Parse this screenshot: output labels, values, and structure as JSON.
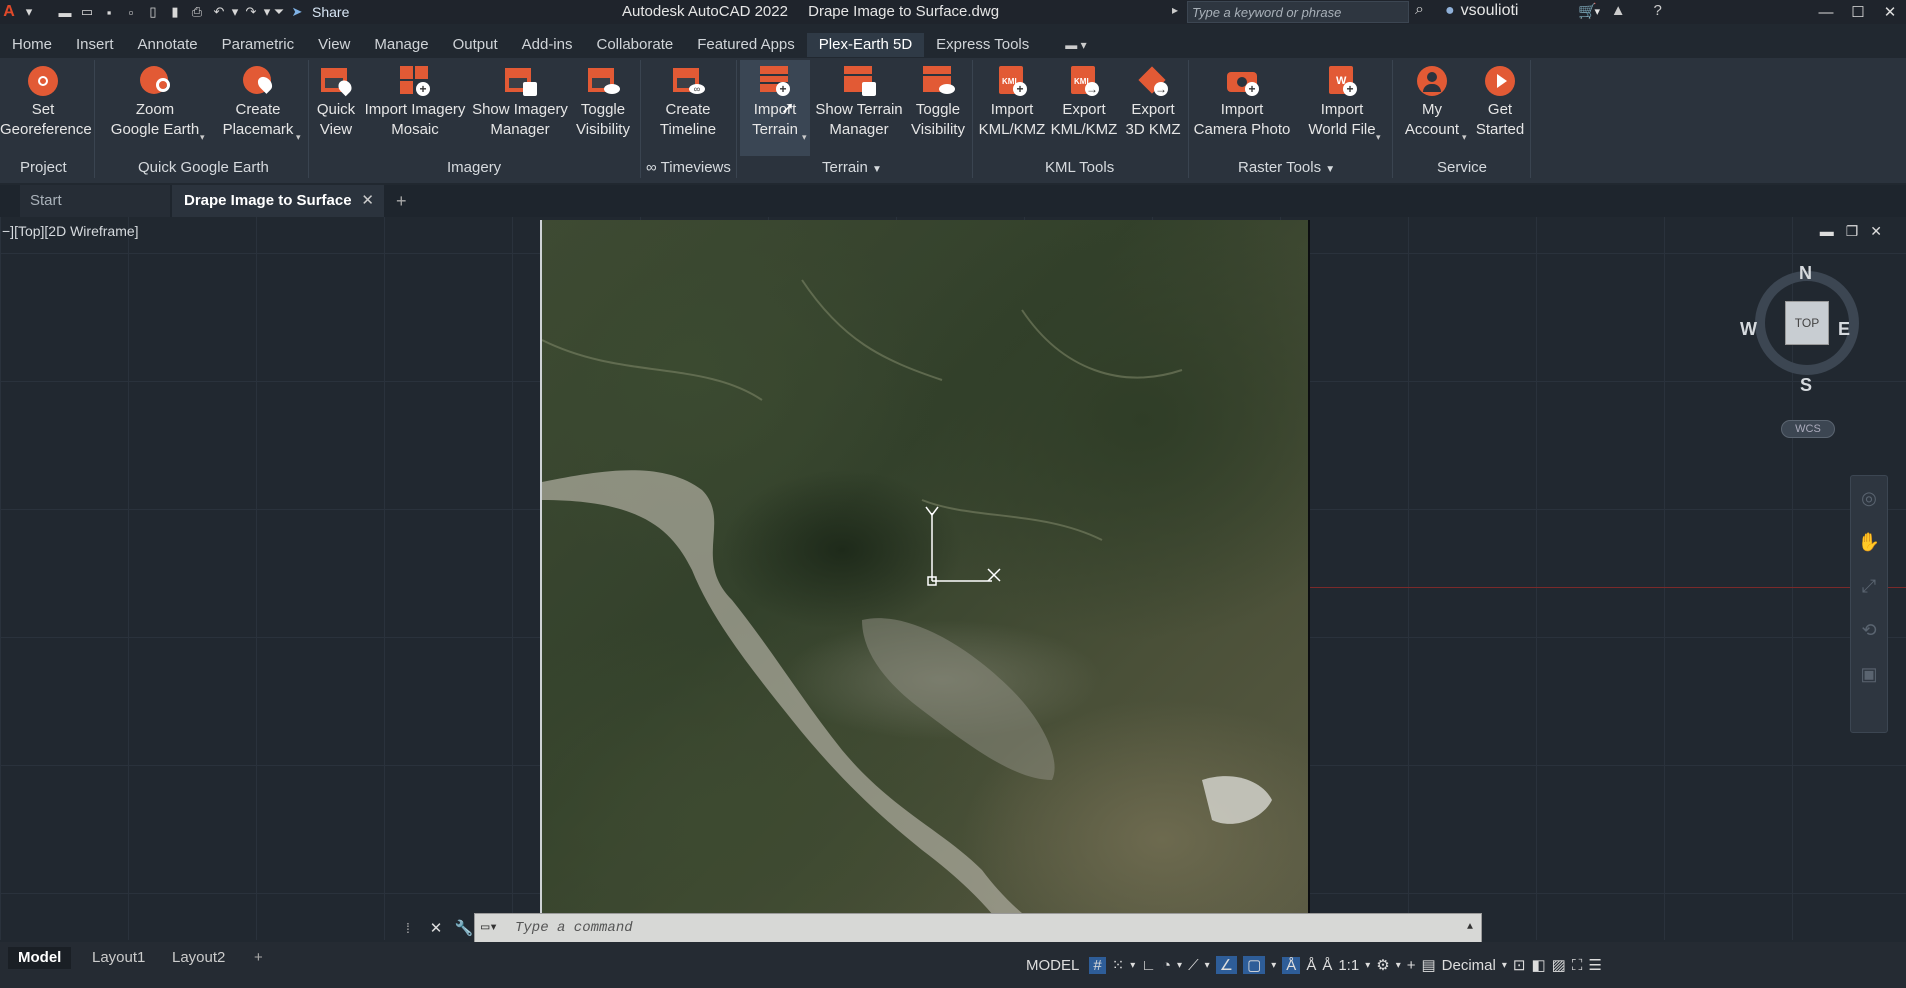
{
  "titlebar": {
    "app_letter": "A",
    "share_label": "Share",
    "app_name": "Autodesk AutoCAD 2022",
    "doc_name": "Drape Image to Surface.dwg",
    "search_placeholder": "Type a keyword or phrase",
    "username": "vsoulioti"
  },
  "ribbon_tabs": [
    "Home",
    "Insert",
    "Annotate",
    "Parametric",
    "View",
    "Manage",
    "Output",
    "Add-ins",
    "Collaborate",
    "Featured Apps",
    "Plex-Earth 5D",
    "Express Tools"
  ],
  "ribbon_buttons": {
    "set_georeference": [
      "Set",
      "Georeference"
    ],
    "zoom_google_earth": [
      "Zoom",
      "Google Earth"
    ],
    "create_placemark": [
      "Create",
      "Placemark"
    ],
    "quick_view": [
      "Quick",
      "View"
    ],
    "import_imagery_mosaic": [
      "Import Imagery",
      "Mosaic"
    ],
    "show_imagery_manager": [
      "Show Imagery",
      "Manager"
    ],
    "toggle_visibility_imagery": [
      "Toggle",
      "Visibility"
    ],
    "create_timeline": [
      "Create",
      "Timeline"
    ],
    "import_terrain": [
      "Import",
      "Terrain"
    ],
    "show_terrain_manager": [
      "Show Terrain",
      "Manager"
    ],
    "toggle_visibility_terrain": [
      "Toggle",
      "Visibility"
    ],
    "import_kml": [
      "Import",
      "KML/KMZ"
    ],
    "export_kml": [
      "Export",
      "KML/KMZ"
    ],
    "export_3d_kmz": [
      "Export",
      "3D KMZ"
    ],
    "import_camera_photo": [
      "Import",
      "Camera Photo"
    ],
    "import_world_file": [
      "Import",
      "World File"
    ],
    "my_account": [
      "My",
      "Account"
    ],
    "get_started": [
      "Get",
      "Started"
    ]
  },
  "panel_labels": {
    "project": "Project",
    "quick_google_earth": "Quick Google Earth",
    "imagery": "Imagery",
    "timeviews": "∞ Timeviews",
    "terrain": "Terrain",
    "kml_tools": "KML Tools",
    "raster_tools": "Raster Tools",
    "service": "Service"
  },
  "doc_tabs": {
    "start": "Start",
    "active": "Drape Image to Surface"
  },
  "viewport": {
    "label": "−][Top][2D Wireframe]",
    "compass": {
      "n": "N",
      "s": "S",
      "e": "E",
      "w": "W",
      "cube": "TOP"
    },
    "wcs": "WCS"
  },
  "command": {
    "placeholder": "Type a command"
  },
  "layout_tabs": [
    "Model",
    "Layout1",
    "Layout2"
  ],
  "status": {
    "model": "MODEL",
    "scale": "1:1",
    "units": "Decimal"
  },
  "colors": {
    "accent_orange": "#e25a35",
    "ribbon_bg": "#2b333d",
    "viewport_bg": "#212830"
  }
}
